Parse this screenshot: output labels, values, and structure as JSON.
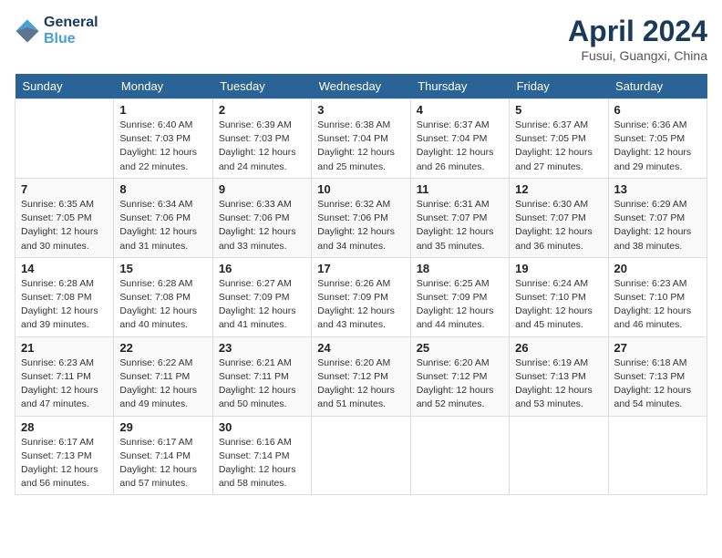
{
  "header": {
    "logo_line1": "General",
    "logo_line2": "Blue",
    "month": "April 2024",
    "location": "Fusui, Guangxi, China"
  },
  "weekdays": [
    "Sunday",
    "Monday",
    "Tuesday",
    "Wednesday",
    "Thursday",
    "Friday",
    "Saturday"
  ],
  "weeks": [
    [
      {
        "day": "",
        "info": ""
      },
      {
        "day": "1",
        "info": "Sunrise: 6:40 AM\nSunset: 7:03 PM\nDaylight: 12 hours\nand 22 minutes."
      },
      {
        "day": "2",
        "info": "Sunrise: 6:39 AM\nSunset: 7:03 PM\nDaylight: 12 hours\nand 24 minutes."
      },
      {
        "day": "3",
        "info": "Sunrise: 6:38 AM\nSunset: 7:04 PM\nDaylight: 12 hours\nand 25 minutes."
      },
      {
        "day": "4",
        "info": "Sunrise: 6:37 AM\nSunset: 7:04 PM\nDaylight: 12 hours\nand 26 minutes."
      },
      {
        "day": "5",
        "info": "Sunrise: 6:37 AM\nSunset: 7:05 PM\nDaylight: 12 hours\nand 27 minutes."
      },
      {
        "day": "6",
        "info": "Sunrise: 6:36 AM\nSunset: 7:05 PM\nDaylight: 12 hours\nand 29 minutes."
      }
    ],
    [
      {
        "day": "7",
        "info": "Sunrise: 6:35 AM\nSunset: 7:05 PM\nDaylight: 12 hours\nand 30 minutes."
      },
      {
        "day": "8",
        "info": "Sunrise: 6:34 AM\nSunset: 7:06 PM\nDaylight: 12 hours\nand 31 minutes."
      },
      {
        "day": "9",
        "info": "Sunrise: 6:33 AM\nSunset: 7:06 PM\nDaylight: 12 hours\nand 33 minutes."
      },
      {
        "day": "10",
        "info": "Sunrise: 6:32 AM\nSunset: 7:06 PM\nDaylight: 12 hours\nand 34 minutes."
      },
      {
        "day": "11",
        "info": "Sunrise: 6:31 AM\nSunset: 7:07 PM\nDaylight: 12 hours\nand 35 minutes."
      },
      {
        "day": "12",
        "info": "Sunrise: 6:30 AM\nSunset: 7:07 PM\nDaylight: 12 hours\nand 36 minutes."
      },
      {
        "day": "13",
        "info": "Sunrise: 6:29 AM\nSunset: 7:07 PM\nDaylight: 12 hours\nand 38 minutes."
      }
    ],
    [
      {
        "day": "14",
        "info": "Sunrise: 6:28 AM\nSunset: 7:08 PM\nDaylight: 12 hours\nand 39 minutes."
      },
      {
        "day": "15",
        "info": "Sunrise: 6:28 AM\nSunset: 7:08 PM\nDaylight: 12 hours\nand 40 minutes."
      },
      {
        "day": "16",
        "info": "Sunrise: 6:27 AM\nSunset: 7:09 PM\nDaylight: 12 hours\nand 41 minutes."
      },
      {
        "day": "17",
        "info": "Sunrise: 6:26 AM\nSunset: 7:09 PM\nDaylight: 12 hours\nand 43 minutes."
      },
      {
        "day": "18",
        "info": "Sunrise: 6:25 AM\nSunset: 7:09 PM\nDaylight: 12 hours\nand 44 minutes."
      },
      {
        "day": "19",
        "info": "Sunrise: 6:24 AM\nSunset: 7:10 PM\nDaylight: 12 hours\nand 45 minutes."
      },
      {
        "day": "20",
        "info": "Sunrise: 6:23 AM\nSunset: 7:10 PM\nDaylight: 12 hours\nand 46 minutes."
      }
    ],
    [
      {
        "day": "21",
        "info": "Sunrise: 6:23 AM\nSunset: 7:11 PM\nDaylight: 12 hours\nand 47 minutes."
      },
      {
        "day": "22",
        "info": "Sunrise: 6:22 AM\nSunset: 7:11 PM\nDaylight: 12 hours\nand 49 minutes."
      },
      {
        "day": "23",
        "info": "Sunrise: 6:21 AM\nSunset: 7:11 PM\nDaylight: 12 hours\nand 50 minutes."
      },
      {
        "day": "24",
        "info": "Sunrise: 6:20 AM\nSunset: 7:12 PM\nDaylight: 12 hours\nand 51 minutes."
      },
      {
        "day": "25",
        "info": "Sunrise: 6:20 AM\nSunset: 7:12 PM\nDaylight: 12 hours\nand 52 minutes."
      },
      {
        "day": "26",
        "info": "Sunrise: 6:19 AM\nSunset: 7:13 PM\nDaylight: 12 hours\nand 53 minutes."
      },
      {
        "day": "27",
        "info": "Sunrise: 6:18 AM\nSunset: 7:13 PM\nDaylight: 12 hours\nand 54 minutes."
      }
    ],
    [
      {
        "day": "28",
        "info": "Sunrise: 6:17 AM\nSunset: 7:13 PM\nDaylight: 12 hours\nand 56 minutes."
      },
      {
        "day": "29",
        "info": "Sunrise: 6:17 AM\nSunset: 7:14 PM\nDaylight: 12 hours\nand 57 minutes."
      },
      {
        "day": "30",
        "info": "Sunrise: 6:16 AM\nSunset: 7:14 PM\nDaylight: 12 hours\nand 58 minutes."
      },
      {
        "day": "",
        "info": ""
      },
      {
        "day": "",
        "info": ""
      },
      {
        "day": "",
        "info": ""
      },
      {
        "day": "",
        "info": ""
      }
    ]
  ]
}
